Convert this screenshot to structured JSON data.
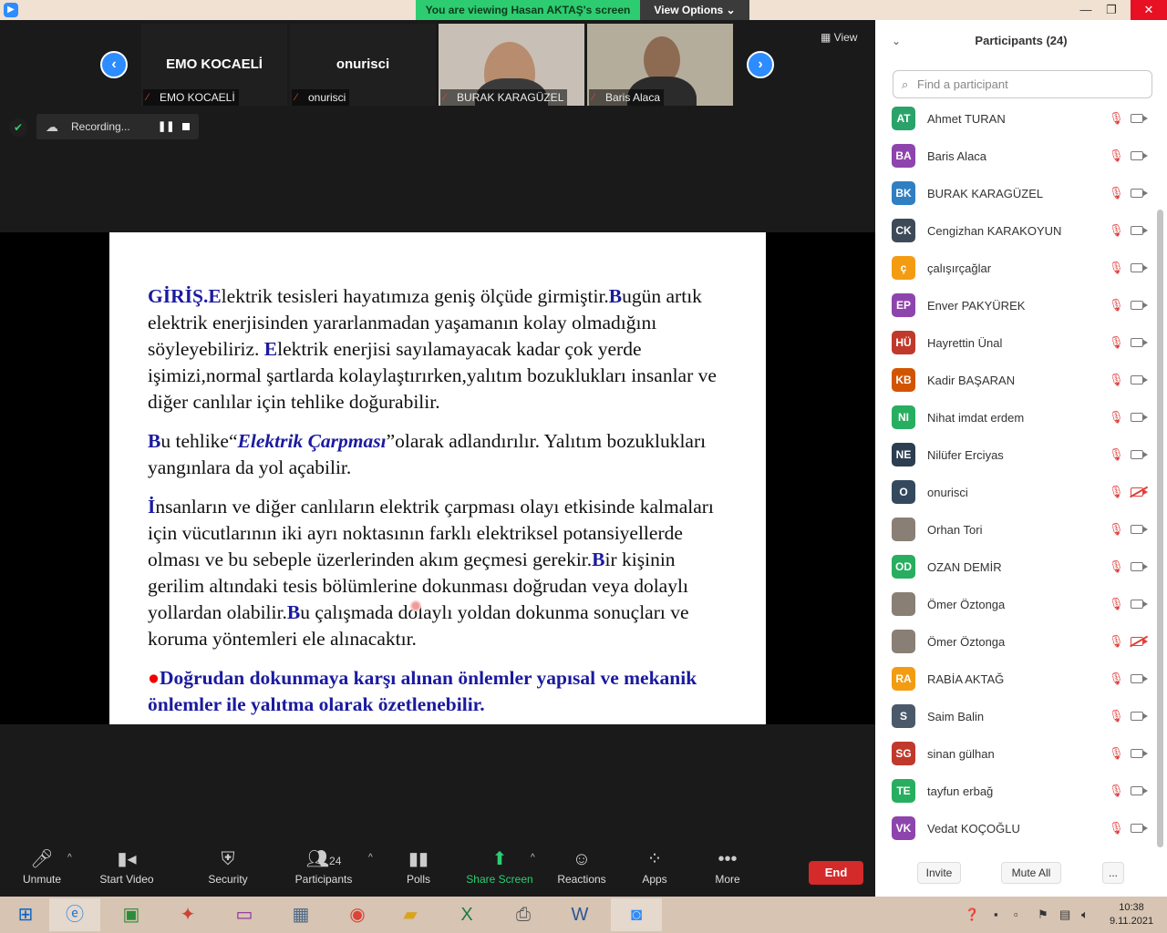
{
  "window": {
    "banner": "You are viewing Hasan AKTAŞ's screen",
    "view_options": "View Options ⌄",
    "minimize": "—",
    "restore": "❐",
    "close": "✕"
  },
  "thumbnails": [
    {
      "big_label": "EMO KOCAELİ",
      "name": "EMO KOCAELİ",
      "video": false
    },
    {
      "big_label": "onurisci",
      "name": "onurisci",
      "video": false
    },
    {
      "big_label": "",
      "name": "BURAK KARAGÜZEL",
      "video": true
    },
    {
      "big_label": "",
      "name": "Baris Alaca",
      "video": true
    }
  ],
  "view_label": "View",
  "recording": {
    "label": "Recording..."
  },
  "slide": {
    "p1": {
      "cap1": "GİRİŞ.",
      "cap1_rest": "E",
      "t1": "lektrik tesisleri hayatımıza geniş ölçüde girmiştir.",
      "cap2": "B",
      "t2": "ugün artık elektrik  enerjisinden yararlanmadan yaşamanın kolay olmadığını söyleyebiliriz. ",
      "cap3": "E",
      "t3": "lektrik enerjisi sayılamayacak kadar çok yerde işimizi,normal şartlarda  kolaylaştırırken,yalıtım bozuklukları insanlar ve diğer canlılar için tehlike doğurabilir."
    },
    "p2": {
      "cap": "B",
      "t1": "u tehlike“",
      "em": "Elektrik Çarpması",
      "t2": "”olarak adlandırılır. Yalıtım bozuklukları yangınlara da yol açabilir."
    },
    "p3": {
      "cap": "İ",
      "t1": "nsanların ve diğer canlıların elektrik çarpması olayı etkisinde kalmaları için vücutlarının iki ayrı noktasının farklı elektriksel potansiyellerde olması ve bu sebeple üzerlerinden akım geçmesi gerekir.",
      "cap2": "B",
      "t2": "ir kişinin gerilim altındaki tesis bölümlerine dokunması doğrudan veya dolaylı yollardan olabilir.",
      "cap3": "B",
      "t3": "u çalışmada dolaylı yoldan dokunma sonuçları ve koruma yöntemleri ele alınacaktır."
    },
    "p4": {
      "bullet": "●",
      "text": "Doğrudan dokunmaya karşı alınan önlemler yapısal ve mekanik önlemler ile yalıtma olarak özetlenebilir."
    }
  },
  "toolbar": {
    "unmute": "Unmute",
    "start_video": "Start Video",
    "security": "Security",
    "participants": "Participants",
    "participants_count": "24",
    "polls": "Polls",
    "share_screen": "Share Screen",
    "reactions": "Reactions",
    "apps": "Apps",
    "more": "More",
    "end": "End"
  },
  "panel": {
    "title": "Participants (24)",
    "search_placeholder": "Find a participant",
    "invite": "Invite",
    "mute_all": "Mute All",
    "more": "...",
    "participants": [
      {
        "initials": "AT",
        "name": "Ahmet TURAN",
        "color": "#2aa36a",
        "cam_off": false
      },
      {
        "initials": "BA",
        "name": "Baris Alaca",
        "color": "#8e44ad",
        "cam_off": false
      },
      {
        "initials": "BK",
        "name": "BURAK KARAGÜZEL",
        "color": "#2f7fc1",
        "cam_off": false
      },
      {
        "initials": "CK",
        "name": "Cengizhan KARAKOYUN",
        "color": "#3d4a57",
        "cam_off": false
      },
      {
        "initials": "ç",
        "name": "çalışırçağlar",
        "color": "#f39c12",
        "cam_off": false
      },
      {
        "initials": "EP",
        "name": "Enver PAKYÜREK",
        "color": "#8e44ad",
        "cam_off": false
      },
      {
        "initials": "HÜ",
        "name": "Hayrettin Ünal",
        "color": "#c0392b",
        "cam_off": false
      },
      {
        "initials": "KB",
        "name": "Kadir BAŞARAN",
        "color": "#d35400",
        "cam_off": false
      },
      {
        "initials": "NI",
        "name": "Nihat imdat erdem",
        "color": "#27ae60",
        "cam_off": false
      },
      {
        "initials": "NE",
        "name": "Nilüfer Erciyas",
        "color": "#2c3e50",
        "cam_off": false
      },
      {
        "initials": "O",
        "name": "onurisci",
        "color": "#34495e",
        "cam_off": true
      },
      {
        "initials": "",
        "name": "Orhan Tori",
        "color": "photo",
        "cam_off": false
      },
      {
        "initials": "OD",
        "name": "OZAN DEMİR",
        "color": "#27ae60",
        "cam_off": false
      },
      {
        "initials": "",
        "name": "Ömer Öztonga",
        "color": "photo",
        "cam_off": false
      },
      {
        "initials": "",
        "name": "Ömer Öztonga",
        "color": "photo",
        "cam_off": true
      },
      {
        "initials": "RA",
        "name": "RABİA AKTAĞ",
        "color": "#f39c12",
        "cam_off": false
      },
      {
        "initials": "S",
        "name": "Saim Balin",
        "color": "#4a5a6a",
        "cam_off": false
      },
      {
        "initials": "SG",
        "name": "sinan gülhan",
        "color": "#c0392b",
        "cam_off": false
      },
      {
        "initials": "TE",
        "name": "tayfun erbağ",
        "color": "#27ae60",
        "cam_off": false
      },
      {
        "initials": "VK",
        "name": "Vedat KOÇOĞLU",
        "color": "#8e44ad",
        "cam_off": false
      }
    ]
  },
  "taskbar": {
    "time": "10:38",
    "date": "9.11.2021"
  }
}
